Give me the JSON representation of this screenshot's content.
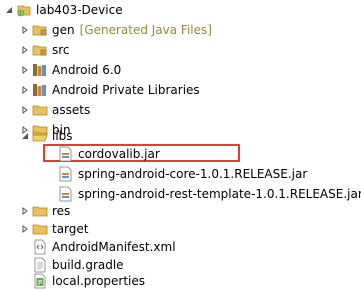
{
  "tree": {
    "project": {
      "label": "lab403-Device"
    },
    "gen": {
      "label": "gen",
      "decoration": "[Generated Java Files]"
    },
    "src": {
      "label": "src"
    },
    "android_lib": {
      "label": "Android 6.0"
    },
    "private_libs": {
      "label": "Android Private Libraries"
    },
    "assets": {
      "label": "assets"
    },
    "bin": {
      "label": "bin"
    },
    "libs": {
      "label": "libs",
      "children": [
        {
          "label": "cordovalib.jar"
        },
        {
          "label": "spring-android-core-1.0.1.RELEASE.jar"
        },
        {
          "label": "spring-android-rest-template-1.0.1.RELEASE.jar"
        }
      ]
    },
    "res": {
      "label": "res"
    },
    "target": {
      "label": "target"
    },
    "manifest": {
      "label": "AndroidManifest.xml"
    },
    "gradle": {
      "label": "build.gradle"
    },
    "local_props": {
      "label": "local.properties"
    }
  },
  "colors": {
    "highlight_border": "#e03c3c",
    "decoration_text": "#958a3b",
    "folder": "#e8c15a",
    "jar": "#6f8fb8"
  }
}
